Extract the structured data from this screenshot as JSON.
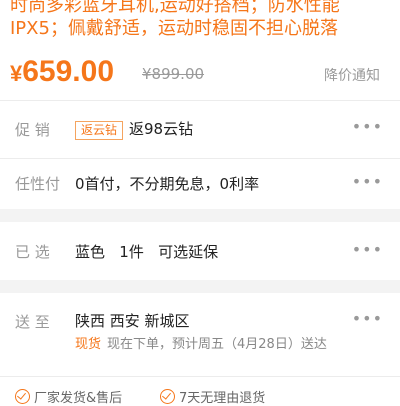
{
  "product": {
    "promo_text": "时尚多彩蓝牙耳机,运动好搭档；防水性能IPX5；佩戴舒适，运动时稳固不担心脱落"
  },
  "price": {
    "currency": "¥",
    "current": "659.00",
    "original": "¥899.00",
    "notify_label": "降价通知"
  },
  "promotion": {
    "label": "促 销",
    "tag": "返云钻",
    "text": "返98云钻"
  },
  "installment": {
    "label": "任性付",
    "text": "0首付，不分期免息，0利率"
  },
  "selected": {
    "label": "已 选",
    "text": "蓝色   1件   可选延保"
  },
  "delivery": {
    "label": "送 至",
    "region": "陕西 西安 新城区",
    "stock_status": "现货",
    "note": "现在下单，预计周五（4月28日）送达"
  },
  "services": [
    "厂家发货&售后",
    "7天无理由退货"
  ],
  "icons": {
    "more": "more-dots-icon",
    "check": "check-circle-icon"
  },
  "colors": {
    "accent": "#f5761a",
    "muted": "#999999",
    "tag_border": "#f5a45f"
  }
}
